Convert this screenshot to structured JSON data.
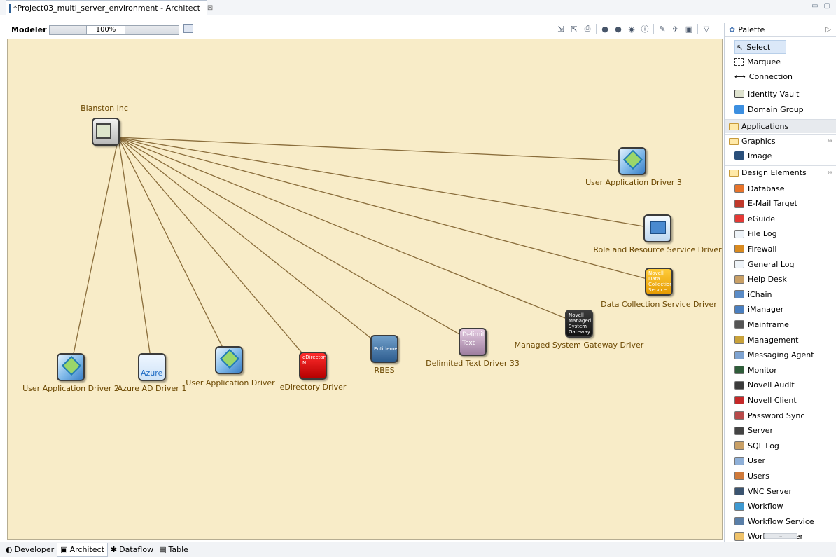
{
  "editor_tab": {
    "title": "*Project03_multi_server_environment - Architect",
    "close": "⊠"
  },
  "window_controls": [
    "▭",
    "▢"
  ],
  "modeler": {
    "label": "Modeler",
    "zoom": "100%"
  },
  "canvas": {
    "hub": {
      "label": "Blanston Inc"
    },
    "nodes": [
      {
        "label": "User Application Driver 3",
        "kind": "ua"
      },
      {
        "label": "Role and Resource Service Driver",
        "kind": "rrs"
      },
      {
        "label": "Data Collection Service Driver",
        "kind": "dcs",
        "icon_text": "Novell Data Collection Service"
      },
      {
        "label": "Managed System Gateway Driver",
        "kind": "msg",
        "icon_text": "Novell Managed System Gateway"
      },
      {
        "label": "Delimited Text Driver 33",
        "kind": "delim",
        "icon_text": "Delimited Text"
      },
      {
        "label": "RBES",
        "kind": "rbes",
        "icon_text": "Entitlement"
      },
      {
        "label": "eDirectory Driver",
        "kind": "edir",
        "icon_text": "eDirectory N"
      },
      {
        "label": "User Application Driver",
        "kind": "ua"
      },
      {
        "label": "Azure AD Driver 1",
        "kind": "azure",
        "icon_text": "Azure"
      },
      {
        "label": "User Application Driver 2",
        "kind": "ua"
      }
    ]
  },
  "palette": {
    "title": "Palette",
    "tools": [
      "Select",
      "Marquee",
      "Connection"
    ],
    "core": [
      "Identity Vault",
      "Domain Group"
    ],
    "drawers": {
      "applications": "Applications",
      "graphics": "Graphics",
      "graphics_items": [
        "Image"
      ],
      "design": "Design Elements",
      "design_items": [
        "Database",
        "E-Mail Target",
        "eGuide",
        "File Log",
        "Firewall",
        "General Log",
        "Help Desk",
        "iChain",
        "iManager",
        "Mainframe",
        "Management",
        "Messaging Agent",
        "Monitor",
        "Novell Audit",
        "Novell Client",
        "Password Sync",
        "Server",
        "SQL Log",
        "User",
        "Users",
        "VNC Server",
        "Workflow",
        "Workflow Service",
        "Workflow User"
      ]
    }
  },
  "bottom_tabs": [
    "Developer",
    "Architect",
    "Dataflow",
    "Table"
  ],
  "colors": {
    "canvas": "#f8ecc8",
    "connector": "#8a6d3b",
    "label": "#6b4700"
  }
}
